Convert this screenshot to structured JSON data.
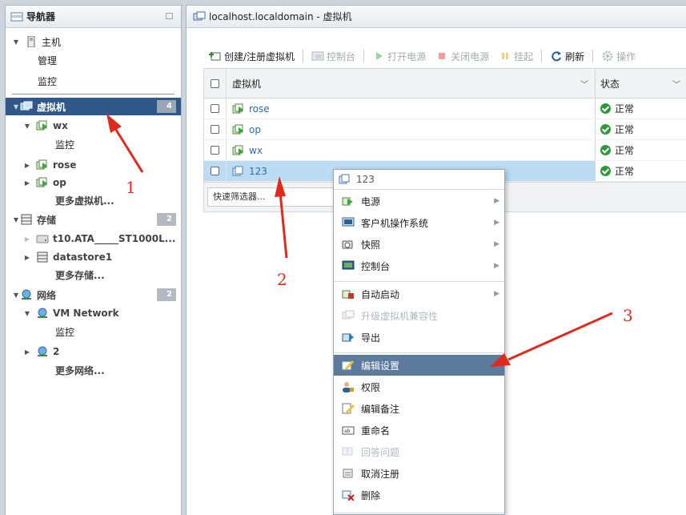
{
  "navigator": {
    "title": "导航器",
    "host": {
      "label": "主机",
      "children": [
        "管理",
        "监控"
      ]
    },
    "vms": {
      "label": "虚拟机",
      "count": "4",
      "wx": {
        "label": "wx",
        "child": "监控"
      },
      "rose": "rose",
      "op": "op",
      "more": "更多虚拟机..."
    },
    "storage": {
      "label": "存储",
      "count": "2",
      "disk": "t10.ATA_____ST1000L...",
      "datastore": "datastore1",
      "more": "更多存储..."
    },
    "network": {
      "label": "网络",
      "count": "2",
      "vmnet": {
        "label": "VM Network",
        "child": "监控"
      },
      "net2": "2",
      "more": "更多网络..."
    }
  },
  "main": {
    "title": "localhost.localdomain - 虚拟机",
    "toolbar": {
      "create": "创建/注册虚拟机",
      "console": "控制台",
      "power_on": "打开电源",
      "power_off": "关闭电源",
      "suspend": "挂起",
      "refresh": "刷新",
      "actions": "操作"
    },
    "table": {
      "col_vm": "虚拟机",
      "col_status": "状态",
      "rows": [
        {
          "name": "rose",
          "status": "正常"
        },
        {
          "name": "op",
          "status": "正常"
        },
        {
          "name": "wx",
          "status": "正常"
        },
        {
          "name": "123",
          "status": "正常"
        }
      ],
      "filter_placeholder": "快速筛选器..."
    }
  },
  "context_menu": {
    "title": "123",
    "items": [
      "电源",
      "客户机操作系统",
      "快照",
      "控制台",
      "自动启动",
      "升级虚拟机兼容性",
      "导出",
      "编辑设置",
      "权限",
      "编辑备注",
      "重命名",
      "回答问题",
      "取消注册",
      "删除"
    ]
  },
  "annotations": {
    "one": "1",
    "two": "2",
    "three": "3"
  },
  "colors": {
    "selected_nav": "#305888",
    "menu_highlight": "#5b7a9c",
    "row_selected": "#bcdcf4",
    "status_ok": "#2d9a3c",
    "annotation": "#e02a1c"
  }
}
